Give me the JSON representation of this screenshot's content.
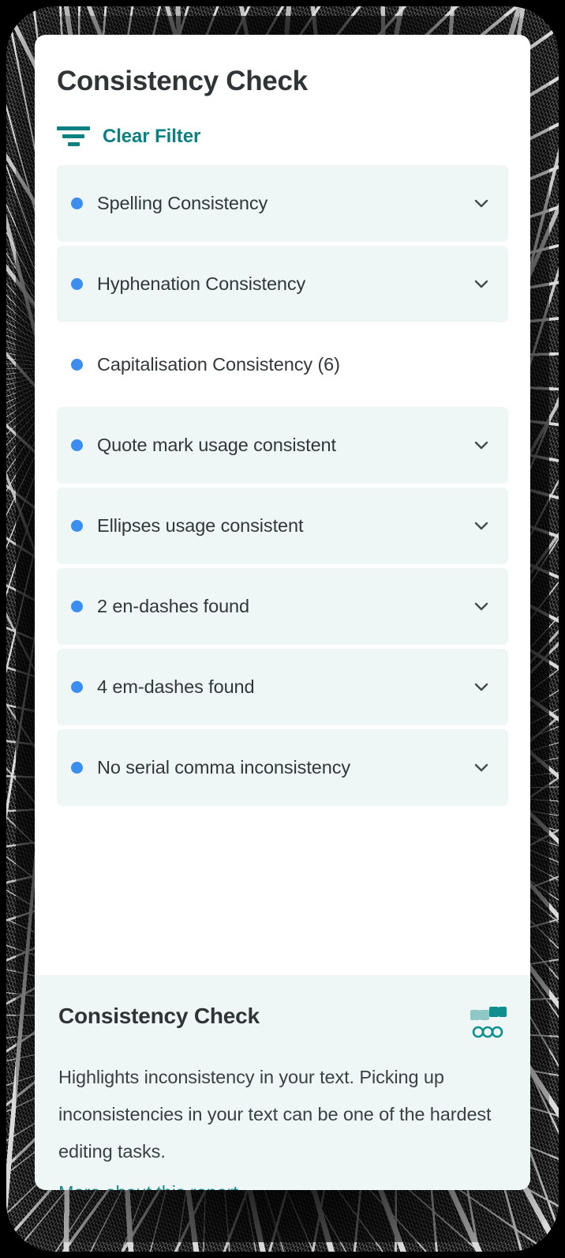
{
  "report": {
    "title": "Consistency Check",
    "clear_filter_label": "Clear Filter",
    "filter_icon": "filter-icon",
    "accent_color": "#0b8080",
    "bullet_color": "#3b8ef0",
    "item_background": "#eef7f5"
  },
  "check_items": [
    {
      "label": "Spelling Consistency",
      "has_chevron": true,
      "highlighted": true
    },
    {
      "label": "Hyphenation Consistency",
      "has_chevron": true,
      "highlighted": true
    },
    {
      "label": "Capitalisation Consistency (6)",
      "has_chevron": false,
      "highlighted": false
    },
    {
      "label": "Quote mark usage consistent",
      "has_chevron": true,
      "highlighted": true
    },
    {
      "label": "Ellipses usage consistent",
      "has_chevron": true,
      "highlighted": true
    },
    {
      "label": "2 en-dashes found",
      "has_chevron": true,
      "highlighted": true
    },
    {
      "label": "4 em-dashes found",
      "has_chevron": true,
      "highlighted": true
    },
    {
      "label": "No serial comma inconsistency",
      "has_chevron": true,
      "highlighted": true
    }
  ],
  "info_panel": {
    "title": "Consistency Check",
    "icon": "quote-glasses-icon",
    "description": "Highlights inconsistency in your text. Picking up inconsistencies in your text can be one of the hardest editing tasks.",
    "link_label": "More about this report",
    "link_color": "#1b8a8a",
    "background": "#eef7f5"
  }
}
